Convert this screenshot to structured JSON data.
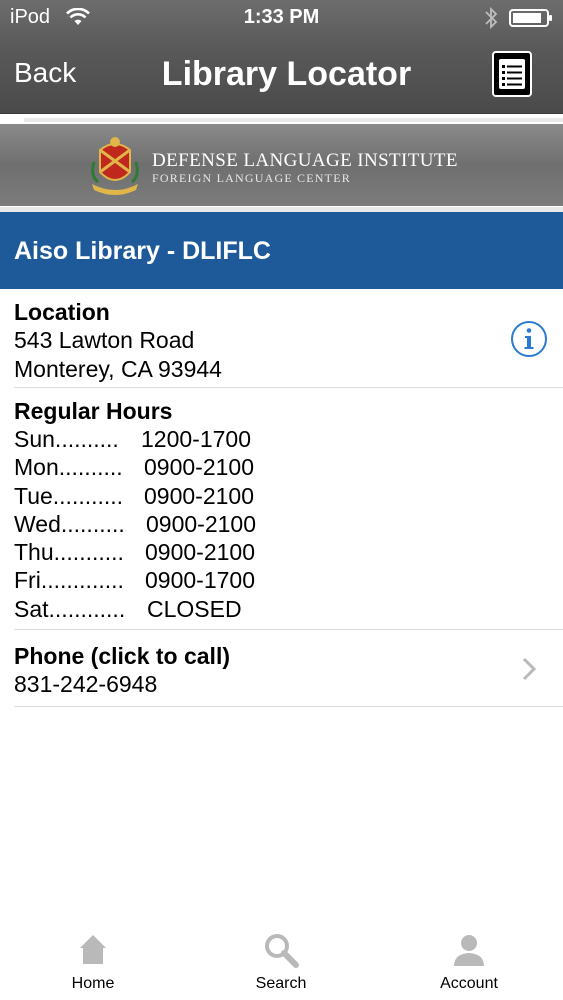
{
  "status_bar": {
    "carrier": "iPod",
    "time": "1:33 PM",
    "wifi_icon": "wifi-icon",
    "bluetooth_icon": "bluetooth-icon",
    "battery_icon": "battery-icon"
  },
  "nav": {
    "back_label": "Back",
    "title": "Library Locator",
    "menu_icon": "list-icon"
  },
  "banner": {
    "title": "DEFENSE LANGUAGE INSTITUTE",
    "subtitle": "FOREIGN LANGUAGE CENTER",
    "logo_icon": "crest-icon"
  },
  "library": {
    "name": "Aiso Library - DLIFLC"
  },
  "location": {
    "heading": "Location",
    "address_line1": "543 Lawton Road",
    "address_line2": "Monterey, CA 93944",
    "info_icon": "info-icon"
  },
  "hours": {
    "heading": "Regular Hours",
    "rows": [
      {
        "day": "Sun..........",
        "hours": "1200-1700"
      },
      {
        "day": "Mon..........",
        "hours": "0900-2100"
      },
      {
        "day": "Tue...........",
        "hours": "0900-2100"
      },
      {
        "day": "Wed..........",
        "hours": "0900-2100"
      },
      {
        "day": "Thu...........",
        "hours": "0900-2100"
      },
      {
        "day": "Fri.............",
        "hours": "0900-1700"
      },
      {
        "day": "Sat............",
        "hours": "CLOSED"
      }
    ]
  },
  "phone": {
    "heading": "Phone (click to call)",
    "number": "831-242-6948",
    "chevron_icon": "chevron-right-icon"
  },
  "tab_bar": {
    "tabs": [
      {
        "label": "Home",
        "icon": "home-icon"
      },
      {
        "label": "Search",
        "icon": "search-icon"
      },
      {
        "label": "Account",
        "icon": "user-icon"
      }
    ]
  },
  "colors": {
    "nav_bg": "#5a5a5a",
    "library_header_bg": "#1e5a9a",
    "info_accent": "#2a7bd0",
    "tab_icon_gray": "#b9b9b9"
  }
}
